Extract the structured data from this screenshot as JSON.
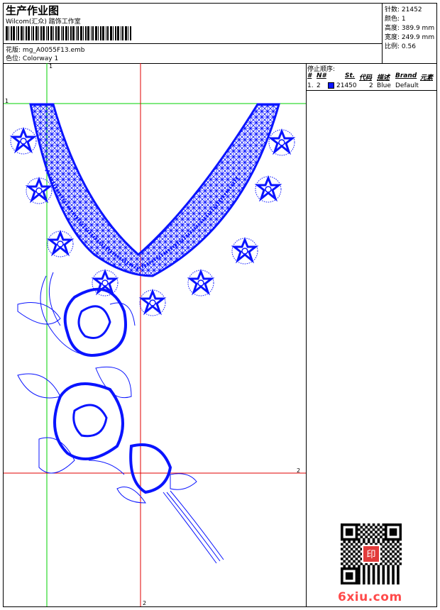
{
  "header": {
    "title": "生产作业图",
    "subtitle": "Wilcom(汇众) 踏饰工作室",
    "design_label": "花版:",
    "design_value": "mg_A0055F13.emb",
    "colorway_label": "色位:",
    "colorway_value": "Colorway 1"
  },
  "stats": [
    {
      "label": "针数:",
      "value": "21452"
    },
    {
      "label": "颜色:",
      "value": "1"
    },
    {
      "label": "高度:",
      "value": "389.9 mm"
    },
    {
      "label": "宽度:",
      "value": "249.9 mm"
    },
    {
      "label": "比例:",
      "value": "0.56"
    }
  ],
  "stop_sequence": {
    "title": "停止顺序:",
    "columns": [
      "#",
      "N#",
      "St.",
      "代码",
      "描述",
      "Brand",
      "元素"
    ],
    "row": {
      "index": "1.",
      "needle": "2",
      "stitches": "21450",
      "code": "2",
      "description": "Blue",
      "brand": "Default",
      "color": "#0a14ff"
    }
  },
  "canvas": {
    "markers": [
      "1",
      "1",
      "2",
      "2"
    ],
    "guide_color_green": "#00d000",
    "guide_color_red": "#e00000",
    "stitch_color": "#0a14ff"
  },
  "watermark": {
    "logo_text": "6xiu.com",
    "qr_stamp_text": "印"
  }
}
